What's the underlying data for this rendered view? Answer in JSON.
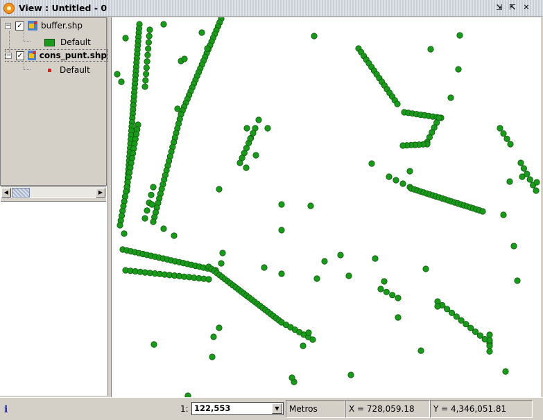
{
  "window": {
    "title": "View : Untitled - 0"
  },
  "toc": {
    "layers": [
      {
        "name": "buffer.shp",
        "checked": true,
        "bold": false,
        "legend_label": "Default",
        "legend_symbol": "polygon-fill-green"
      },
      {
        "name": "cons_punt.shp",
        "checked": true,
        "bold": true,
        "legend_label": "Default",
        "legend_symbol": "point-red"
      }
    ]
  },
  "status": {
    "info_icon": "i",
    "scale_prefix": "1:",
    "scale_value": "122,553",
    "units": "Metros",
    "x": "X = 728,059.18",
    "y": "Y = 4,346,051.81"
  },
  "colors": {
    "point_fill": "#1a9a1a",
    "point_stroke": "#0c5a0c",
    "layer_color": "#1a9a1a"
  }
}
